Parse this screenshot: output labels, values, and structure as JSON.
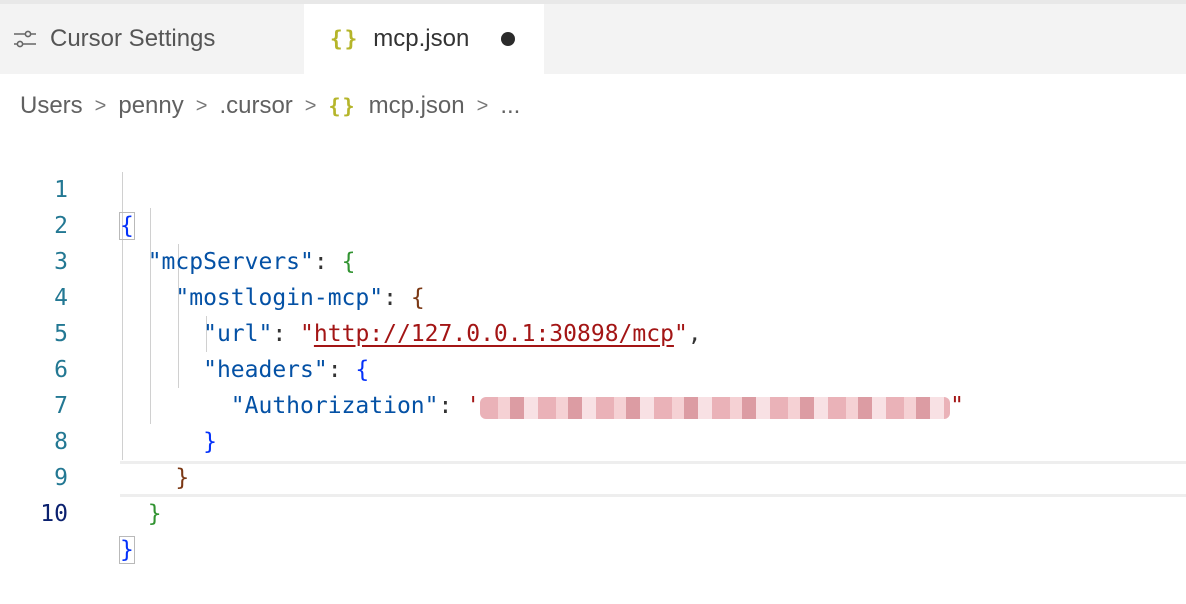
{
  "tabs": {
    "settings": {
      "label": "Cursor Settings",
      "icon": "sliders-icon"
    },
    "file": {
      "label": "mcp.json",
      "icon": "json-braces-icon",
      "braces": "{}",
      "modified": true
    }
  },
  "breadcrumb": {
    "items": [
      "Users",
      "penny",
      ".cursor",
      "mcp.json",
      "..."
    ],
    "separator": ">"
  },
  "editor": {
    "line_numbers": [
      "1",
      "2",
      "3",
      "4",
      "5",
      "6",
      "7",
      "8",
      "9",
      "10"
    ],
    "active_line": "10",
    "tokens": {
      "open_brace": "{",
      "close_brace": "}",
      "colon": ": ",
      "comma": ",",
      "key_mcpServers": "\"mcpServers\"",
      "key_mostlogin": "\"mostlogin-mcp\"",
      "key_url": "\"url\"",
      "url_quote_open": "\"",
      "url_value": "http://127.0.0.1:30898/mcp",
      "url_quote_close": "\"",
      "key_headers": "\"headers\"",
      "key_authorization": "\"Authorization\"",
      "auth_quote_open": "'",
      "auth_quote_close": "\""
    }
  },
  "colors": {
    "key": "#0451a5",
    "string": "#a31515",
    "bracket_level1": "#0431fa",
    "bracket_level2": "#319331",
    "bracket_level3": "#7b3814",
    "line_number": "#237893"
  }
}
